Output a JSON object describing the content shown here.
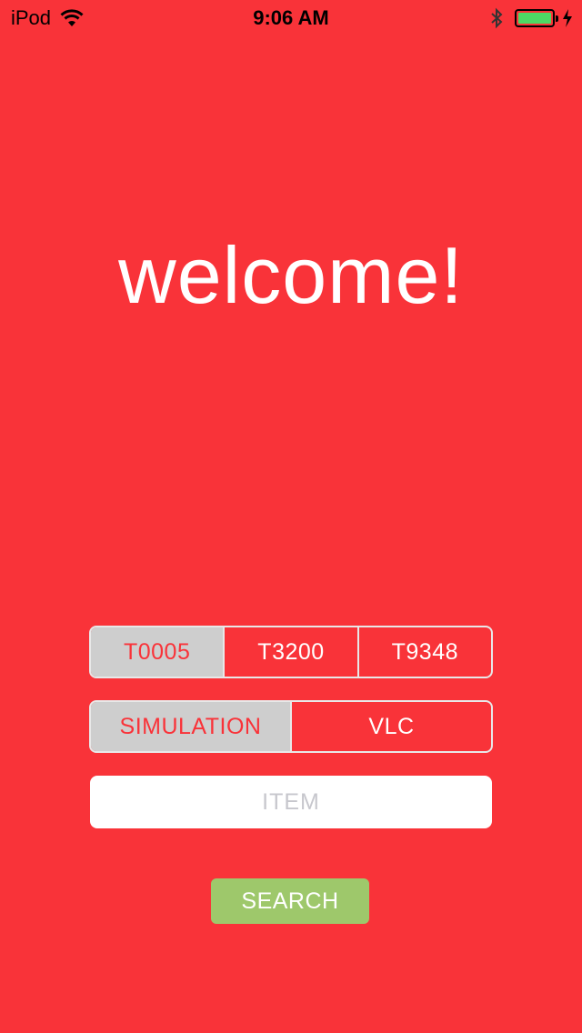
{
  "status_bar": {
    "carrier": "iPod",
    "time": "9:06 AM",
    "battery_color": "#4cd964"
  },
  "welcome_text": "welcome!",
  "device_selector": {
    "options": [
      "T0005",
      "T3200",
      "T9348"
    ],
    "selected": "T0005"
  },
  "mode_selector": {
    "options": [
      "SIMULATION",
      "VLC"
    ],
    "selected": "SIMULATION"
  },
  "item_input": {
    "placeholder": "ITEM",
    "value": ""
  },
  "search_button": {
    "label": "SEARCH"
  },
  "colors": {
    "background": "#f93339",
    "selected_segment": "#cecece",
    "search_button": "#9ec86b"
  }
}
